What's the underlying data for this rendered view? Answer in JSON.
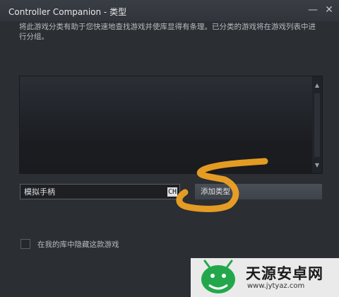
{
  "window": {
    "title": "Controller Companion - 类型",
    "minimize_glyph": "—",
    "close_glyph": "✕"
  },
  "description": "将此游戏分类有助于您快速地查找游戏并使库显得有条理。已分类的游戏将在游戏列表中进行分组。",
  "category_input": {
    "value": "模拟手柄",
    "ime_indicator": "CH"
  },
  "add_button": {
    "label": "添加类型"
  },
  "hide_checkbox": {
    "label": "在我的库中隐藏这款游戏",
    "checked": false
  },
  "scrollbar": {
    "up_glyph": "▲",
    "down_glyph": "▼"
  },
  "watermark": {
    "text": "天源安卓网",
    "url": "www.jytyaz.com"
  },
  "colors": {
    "background": "#2b2e33",
    "annotation": "#f5a623",
    "watermark_icon": "#22a84a"
  }
}
